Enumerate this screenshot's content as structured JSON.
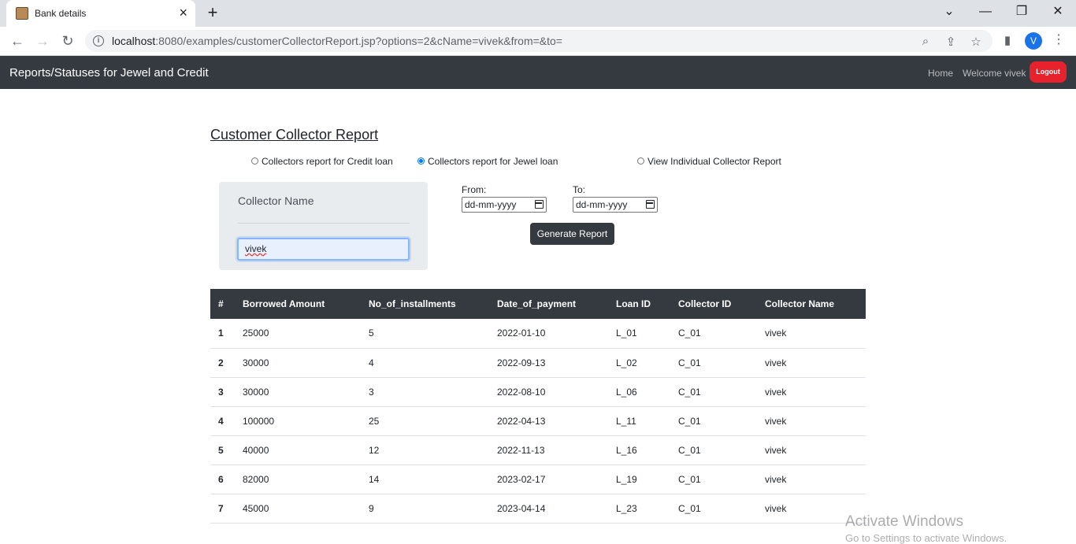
{
  "browser": {
    "tab_title": "Bank details",
    "url_host": "localhost",
    "url_rest": ":8080/examples/customerCollectorReport.jsp?options=2&cName=vivek&from=&to=",
    "profile_initial": "V"
  },
  "navbar": {
    "brand": "Reports/Statuses for Jewel and Credit",
    "home": "Home",
    "welcome": "Welcome vivek",
    "logout": "Logout"
  },
  "page": {
    "title": "Customer Collector Report",
    "radios": [
      {
        "label": "Collectors report for Credit loan",
        "checked": false
      },
      {
        "label": "Collectors report for Jewel loan",
        "checked": true
      },
      {
        "label": "View Individual Collector Report",
        "checked": false
      }
    ],
    "collector_label": "Collector Name",
    "collector_value": "vivek",
    "from_label": "From:",
    "to_label": "To:",
    "date_placeholder": "dd-mm-yyyy",
    "generate_button": "Generate Report"
  },
  "table": {
    "headers": [
      "#",
      "Borrowed Amount",
      "No_of_installments",
      "Date_of_payment",
      "Loan ID",
      "Collector ID",
      "Collector Name"
    ],
    "rows": [
      [
        "1",
        "25000",
        "5",
        "2022-01-10",
        "L_01",
        "C_01",
        "vivek"
      ],
      [
        "2",
        "30000",
        "4",
        "2022-09-13",
        "L_02",
        "C_01",
        "vivek"
      ],
      [
        "3",
        "30000",
        "3",
        "2022-08-10",
        "L_06",
        "C_01",
        "vivek"
      ],
      [
        "4",
        "100000",
        "25",
        "2022-04-13",
        "L_11",
        "C_01",
        "vivek"
      ],
      [
        "5",
        "40000",
        "12",
        "2022-11-13",
        "L_16",
        "C_01",
        "vivek"
      ],
      [
        "6",
        "82000",
        "14",
        "2023-02-17",
        "L_19",
        "C_01",
        "vivek"
      ],
      [
        "7",
        "45000",
        "9",
        "2023-04-14",
        "L_23",
        "C_01",
        "vivek"
      ]
    ]
  },
  "os": {
    "watermark_title": "Activate Windows",
    "watermark_sub": "Go to Settings to activate Windows."
  },
  "colors": {
    "navbar_bg": "#343a40",
    "logout_bg": "#e8222c",
    "accent": "#0075ff"
  }
}
